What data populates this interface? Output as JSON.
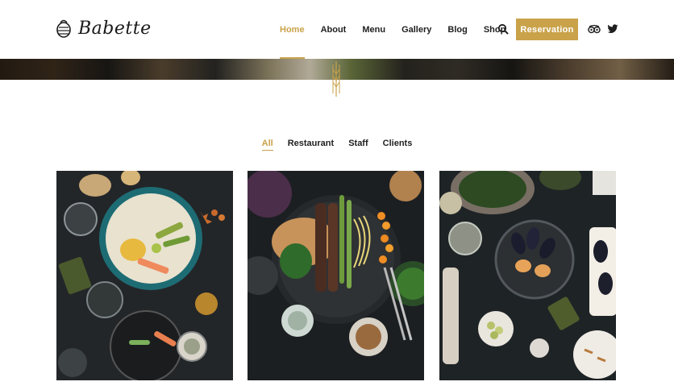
{
  "header": {
    "brand": "Babette",
    "nav": [
      {
        "label": "Home",
        "active": true
      },
      {
        "label": "About",
        "active": false
      },
      {
        "label": "Menu",
        "active": false
      },
      {
        "label": "Gallery",
        "active": false
      },
      {
        "label": "Blog",
        "active": false
      },
      {
        "label": "Shop",
        "active": false
      }
    ],
    "search_icon": "search-icon",
    "reservation_label": "Reservation",
    "social_icons": [
      "tripadvisor-icon",
      "twitter-icon"
    ]
  },
  "colors": {
    "accent": "#c9a24a",
    "text": "#1f1f1f",
    "photo_background": "#1e2124"
  },
  "filters": [
    {
      "label": "All",
      "active": true
    },
    {
      "label": "Restaurant",
      "active": false
    },
    {
      "label": "Staff",
      "active": false
    },
    {
      "label": "Clients",
      "active": false
    }
  ],
  "gallery": [
    {
      "name": "gallery-item-salmon-plate"
    },
    {
      "name": "gallery-item-grilled-skewers"
    },
    {
      "name": "gallery-item-mussels"
    }
  ]
}
